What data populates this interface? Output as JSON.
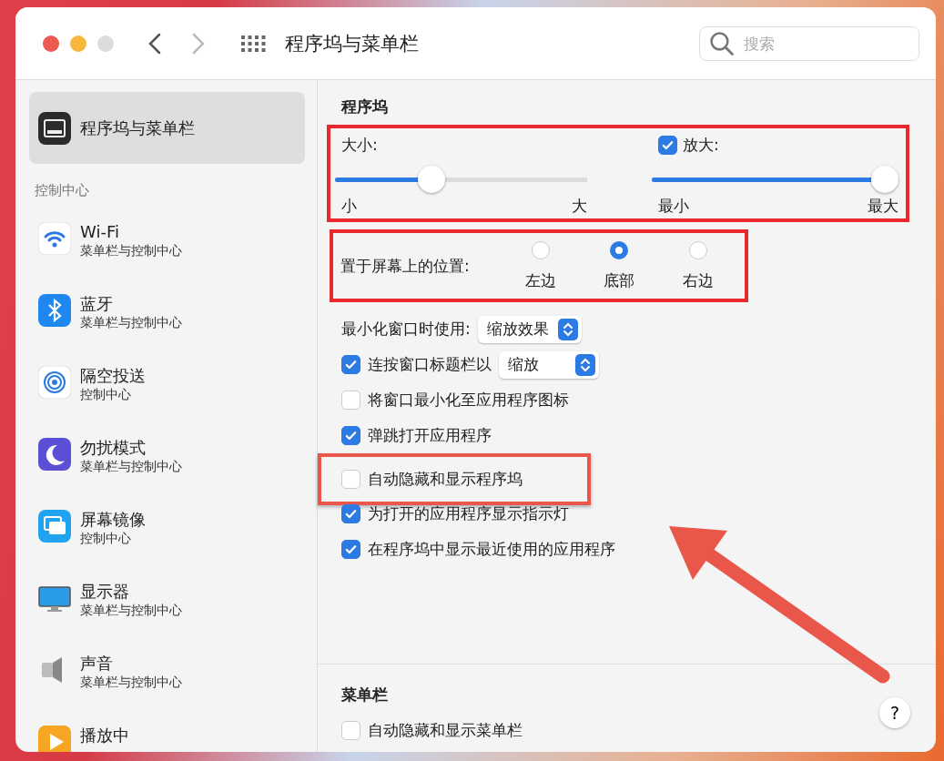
{
  "window": {
    "title": "程序坞与菜单栏",
    "search": {
      "placeholder": "搜索"
    }
  },
  "sidebar": {
    "items": [
      {
        "kind": "dock",
        "title": "程序坞与菜单栏",
        "selected": true
      }
    ],
    "sections": [
      {
        "title": "控制中心",
        "items": [
          {
            "kind": "wifi",
            "title": "Wi-Fi",
            "subtitle": "菜单栏与控制中心",
            "selected": false
          },
          {
            "kind": "bluetooth",
            "title": "蓝牙",
            "subtitle": "菜单栏与控制中心",
            "selected": false
          },
          {
            "kind": "airdrop",
            "title": "隔空投送",
            "subtitle": "控制中心",
            "selected": false
          },
          {
            "kind": "focus",
            "title": "勿扰模式",
            "subtitle": "菜单栏与控制中心",
            "selected": false
          },
          {
            "kind": "mirroring",
            "title": "屏幕镜像",
            "subtitle": "控制中心",
            "selected": false
          },
          {
            "kind": "display",
            "title": "显示器",
            "subtitle": "菜单栏与控制中心",
            "selected": false
          },
          {
            "kind": "sound",
            "title": "声音",
            "subtitle": "菜单栏与控制中心",
            "selected": false
          },
          {
            "kind": "nowplaying",
            "title": "播放中",
            "selected": false
          }
        ]
      }
    ]
  },
  "dock": {
    "title": "程序坞",
    "sliders_highlighted": true,
    "size": {
      "label": "大小:",
      "level": 0.37,
      "min_label": "小",
      "max_label": "大"
    },
    "magnification": {
      "label": "放大:",
      "checked": true,
      "level": 1.0,
      "min_label": "最小",
      "max_label": "最大"
    },
    "position": {
      "label": "置于屏幕上的位置:",
      "highlighted": true,
      "options": [
        {
          "label": "左边",
          "selected": false
        },
        {
          "label": "底部",
          "selected": true
        },
        {
          "label": "右边",
          "selected": false
        }
      ]
    },
    "minimize_effect": {
      "label": "最小化窗口时使用:",
      "value": "缩放效果"
    },
    "double_click": {
      "label": "连按窗口标题栏以",
      "checked": true,
      "value": "缩放"
    },
    "options": [
      {
        "label": "将窗口最小化至应用程序图标",
        "checked": false,
        "highlighted": false
      },
      {
        "label": "弹跳打开应用程序",
        "checked": true,
        "highlighted": false
      },
      {
        "label": "自动隐藏和显示程序坞",
        "checked": false,
        "highlighted": true
      },
      {
        "label": "为打开的应用程序显示指示灯",
        "checked": true,
        "highlighted": false
      },
      {
        "label": "在程序坞中显示最近使用的应用程序",
        "checked": true,
        "highlighted": false
      }
    ]
  },
  "menu_bar": {
    "title": "菜单栏",
    "options": [
      {
        "label": "自动隐藏和显示菜单栏",
        "checked": false
      }
    ]
  },
  "help": {
    "label": "?"
  },
  "annotation_arrow": true
}
